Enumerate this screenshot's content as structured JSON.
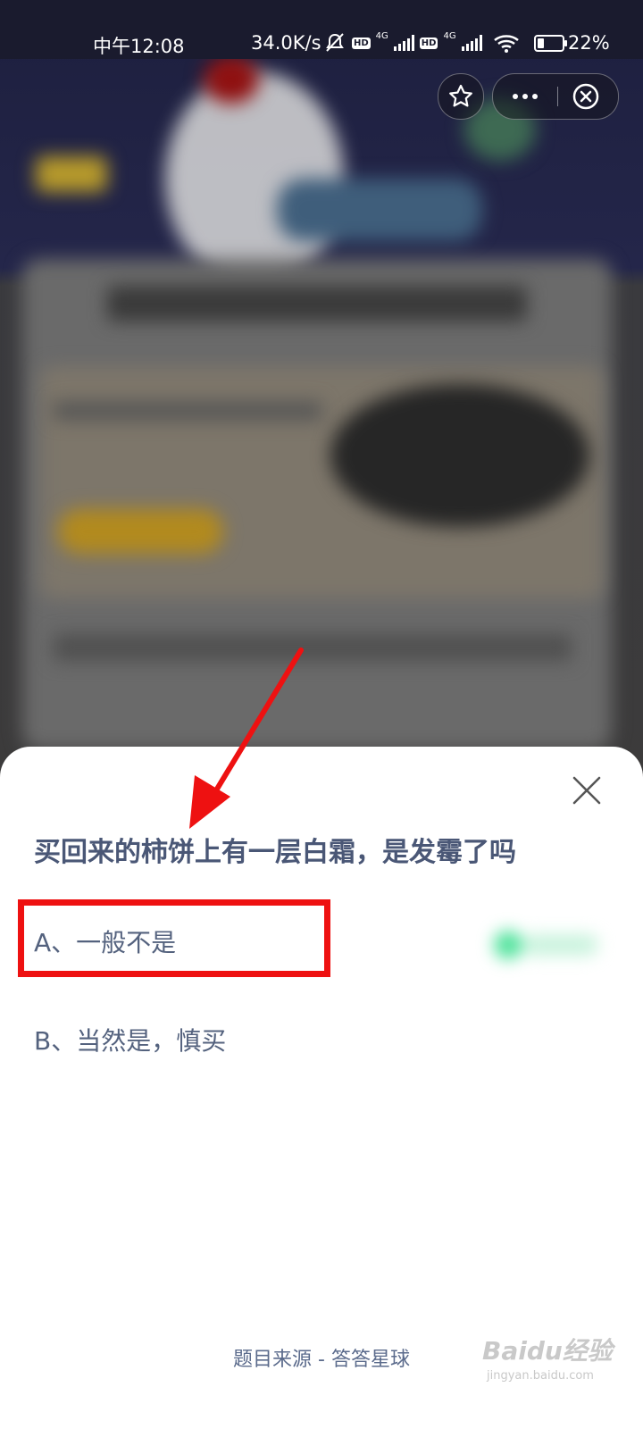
{
  "status_bar": {
    "time": "中午12:08",
    "network_speed": "34.0K/s",
    "hd_label": "HD",
    "network_type": "4G",
    "battery_percent": "22%"
  },
  "capsule": {
    "star_icon": "star-icon",
    "more_icon": "more-dots-icon",
    "close_icon": "close-circle-icon"
  },
  "quiz": {
    "question": "买回来的柿饼上有一层白霜，是发霉了吗",
    "options": [
      {
        "label": "A、一般不是"
      },
      {
        "label": "B、当然是，慎买"
      }
    ],
    "source": "题目来源 - 答答星球"
  },
  "watermark": {
    "brand": "Baidu经验",
    "url": "jingyan.baidu.com"
  },
  "annotation": {
    "highlight_color": "#ee1111"
  }
}
